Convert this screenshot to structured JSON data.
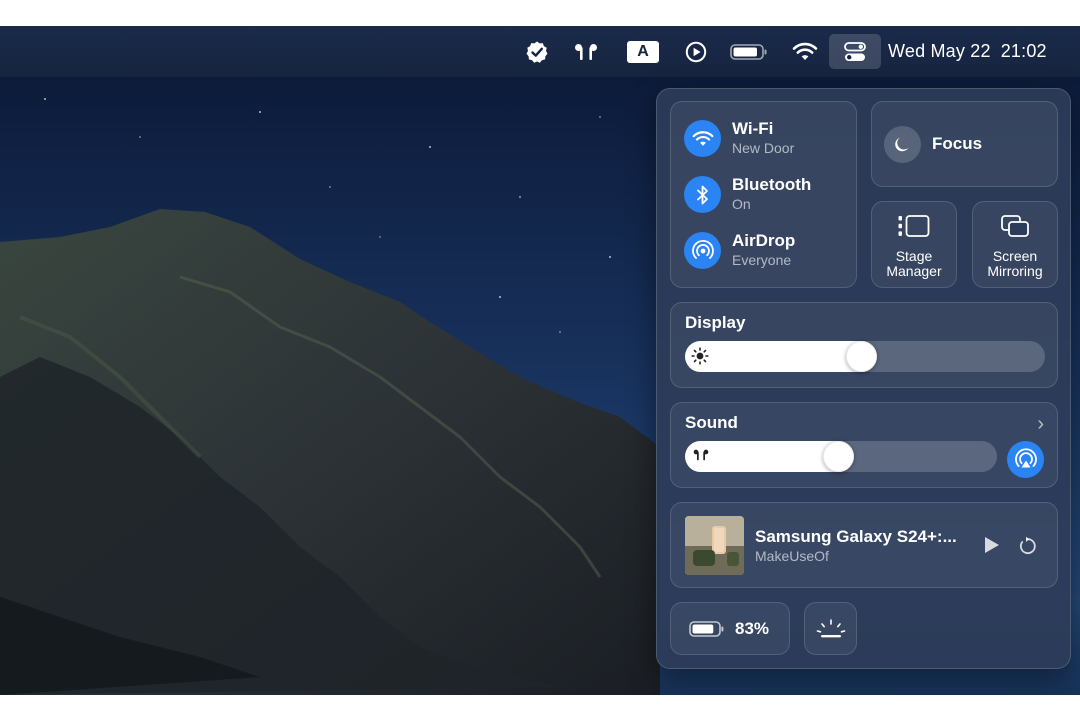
{
  "menubar": {
    "icons": [
      "checkmark-badge-icon",
      "airpods-icon",
      "input-source-icon",
      "play-circle-icon",
      "battery-icon",
      "wifi-icon",
      "control-center-icon"
    ],
    "input_source_letter": "A",
    "date": "Wed May 22",
    "time": "21:02"
  },
  "control_center": {
    "connectivity": [
      {
        "title": "Wi-Fi",
        "subtitle": "New Door",
        "icon": "wifi-icon"
      },
      {
        "title": "Bluetooth",
        "subtitle": "On",
        "icon": "bluetooth-icon"
      },
      {
        "title": "AirDrop",
        "subtitle": "Everyone",
        "icon": "airdrop-icon"
      }
    ],
    "focus": {
      "label": "Focus",
      "icon": "moon-icon"
    },
    "stage_manager": {
      "label_line1": "Stage",
      "label_line2": "Manager",
      "icon": "stage-manager-icon"
    },
    "screen_mirroring": {
      "label_line1": "Screen",
      "label_line2": "Mirroring",
      "icon": "screen-mirroring-icon"
    },
    "display": {
      "title": "Display",
      "brightness_level": 0.49,
      "icon": "sun-icon"
    },
    "sound": {
      "title": "Sound",
      "volume_level": 0.49,
      "icon": "airpods-icon",
      "output_icon": "airplay-audio-icon"
    },
    "now_playing": {
      "title": "Samsung Galaxy S24+:...",
      "source": "MakeUseOf",
      "icon_play": "play-icon",
      "icon_replay": "replay-icon"
    },
    "battery": {
      "percent_label": "83%",
      "level": 0.83,
      "icon": "battery-icon"
    },
    "keyboard_brightness": {
      "icon": "keyboard-brightness-icon"
    }
  },
  "colors": {
    "accent": "#2a84f4",
    "panel": "#2d3c58",
    "menubar": "#1a2a4a"
  }
}
